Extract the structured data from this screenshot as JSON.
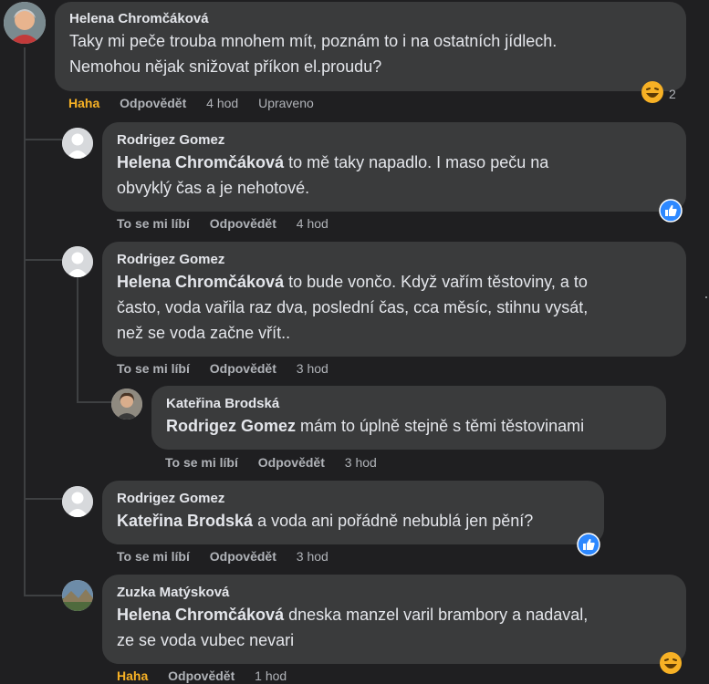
{
  "comments": [
    {
      "author": "Helena Chromčáková",
      "line1": "Taky mi peče trouba mnohem mít, poznám to i na ostatních jídlech.",
      "line2": "Nemohou nějak snižovat příkon el.proudu?",
      "actions": {
        "reaction": "Haha",
        "reply": "Odpovědět",
        "time": "4 hod",
        "edited": "Upraveno"
      },
      "reaction_count": "2",
      "reaction_icon": "haha-emoji-icon"
    },
    {
      "author": "Rodrigez Gomez",
      "mention": "Helena Chromčáková",
      "line1": " to mě taky napadlo. I maso peču na",
      "line2": "obvyklý čas a je nehotové.",
      "actions": {
        "like": "To se mi líbí",
        "reply": "Odpovědět",
        "time": "4 hod"
      },
      "reaction_icon": "like-icon"
    },
    {
      "author": "Rodrigez Gomez",
      "mention": "Helena Chromčáková",
      "line1": " to bude vončo. Když vařím těstoviny, a to",
      "line2": "často, voda vařila raz dva, poslední čas, cca měsíc, stihnu vysát,",
      "line3": "než se voda začne vřít..",
      "actions": {
        "like": "To se mi líbí",
        "reply": "Odpovědět",
        "time": "3 hod"
      }
    },
    {
      "author": "Kateřina Brodská",
      "mention": "Rodrigez Gomez",
      "line1": " mám to úplně stejně s těmi těstovinami",
      "actions": {
        "like": "To se mi líbí",
        "reply": "Odpovědět",
        "time": "3 hod"
      }
    },
    {
      "author": "Rodrigez Gomez",
      "mention": "Kateřina Brodská",
      "line1": " a voda ani pořádně nebublá jen pění?",
      "actions": {
        "like": "To se mi líbí",
        "reply": "Odpovědět",
        "time": "3 hod"
      },
      "reaction_icon": "like-icon"
    },
    {
      "author": "Zuzka Matýsková",
      "mention": "Helena Chromčáková",
      "line1": " dneska manzel varil brambory a nadaval,",
      "line2": "ze se voda vubec nevari",
      "actions": {
        "reaction": "Haha",
        "reply": "Odpovědět",
        "time": "1 hod"
      },
      "reaction_icon": "haha-emoji-icon"
    }
  ],
  "colors": {
    "background": "#1f1f21",
    "bubble": "#3a3b3c",
    "text": "#e4e6eb",
    "muted": "#b0b3b8",
    "haha": "#f7b125",
    "like": "#2d88ff"
  }
}
